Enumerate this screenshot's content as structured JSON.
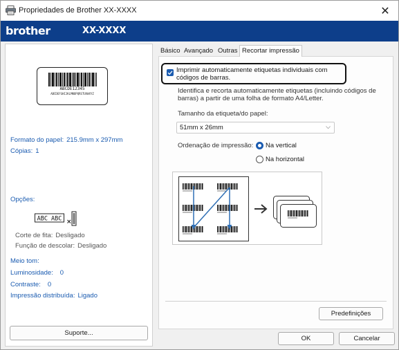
{
  "window": {
    "title": "Propriedades de Brother XX-XXXX",
    "close_glyph": "✕"
  },
  "brand": {
    "logo": "brother",
    "model": "XX-XXXX",
    "bar_color": "#0d3e8a"
  },
  "left": {
    "preview": {
      "code": "ABCDE12345",
      "subtext": "ABCDEFGHIJKLMNOPQRSTUVWXYZ"
    },
    "paper_format": {
      "label": "Formato do papel:",
      "value": "215.9mm x 297mm"
    },
    "copies": {
      "label": "Cópias:",
      "value": "1"
    },
    "options_label": "Opções:",
    "option_graphic_text": "ABC ABC",
    "tape_cut": {
      "label": "Corte de fita:",
      "value": "Desligado"
    },
    "peel_function": {
      "label": "Função de descolar:",
      "value": "Desligado"
    },
    "halftone": {
      "label": "Meio tom:",
      "value": ""
    },
    "brightness": {
      "label": "Luminosidade:",
      "value": "0"
    },
    "contrast": {
      "label": "Contraste:",
      "value": "0"
    },
    "distributed_print": {
      "label": "Impressão distribuída:",
      "value": "Ligado"
    },
    "support_button": "Suporte..."
  },
  "tabs": [
    {
      "label": "Básico",
      "active": false
    },
    {
      "label": "Avançado",
      "active": false
    },
    {
      "label": "Outras",
      "active": false
    },
    {
      "label": "Recortar impressão",
      "active": true
    }
  ],
  "crop": {
    "checkbox_checked": true,
    "checkbox_label": "Imprimir automaticamente etiquetas individuais com códigos de barras.",
    "description": "Identifica e recorta automaticamente etiquetas (incluindo códigos de barras) a partir de uma folha de formato A4/Letter.",
    "size_label": "Tamanho da etiqueta/do papel:",
    "size_value": "51mm x 26mm",
    "order_label": "Ordenação de impressão:",
    "order_options": [
      {
        "label": "Na vertical",
        "selected": true
      },
      {
        "label": "Na horizontal",
        "selected": false
      }
    ]
  },
  "buttons": {
    "defaults": "Predefinições",
    "ok": "OK",
    "cancel": "Cancelar"
  },
  "colors": {
    "accent": "#1a5bb0",
    "info_text": "#1a5bb0"
  }
}
